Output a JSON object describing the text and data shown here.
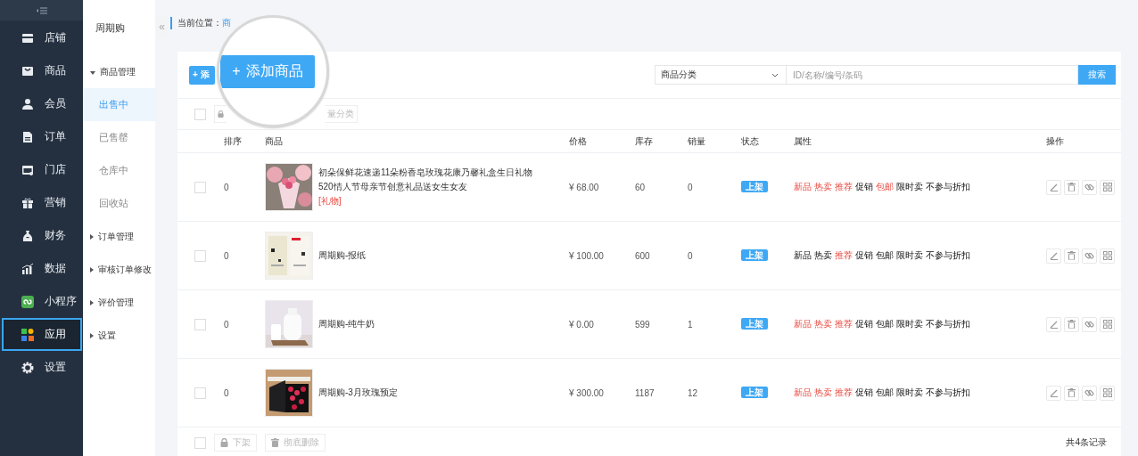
{
  "nav": {
    "items": [
      {
        "label": "店铺",
        "selected": false
      },
      {
        "label": "商品",
        "selected": false
      },
      {
        "label": "会员",
        "selected": false
      },
      {
        "label": "订单",
        "selected": false
      },
      {
        "label": "门店",
        "selected": false
      },
      {
        "label": "营销",
        "selected": false
      },
      {
        "label": "财务",
        "selected": false
      },
      {
        "label": "数据",
        "selected": false
      },
      {
        "label": "小程序",
        "selected": false
      },
      {
        "label": "应用",
        "selected": true
      },
      {
        "label": "设置",
        "selected": false
      }
    ]
  },
  "subnav": {
    "title": "周期购",
    "collapse": "«",
    "groups": [
      {
        "label": "商品管理",
        "expanded": true,
        "children": [
          {
            "label": "出售中",
            "selected": true
          },
          {
            "label": "已售罄",
            "selected": false
          },
          {
            "label": "仓库中",
            "selected": false
          },
          {
            "label": "回收站",
            "selected": false
          }
        ]
      },
      {
        "label": "订单管理",
        "expanded": false
      },
      {
        "label": "审核订单修改",
        "expanded": false
      },
      {
        "label": "评价管理",
        "expanded": false
      },
      {
        "label": "设置",
        "expanded": false
      }
    ]
  },
  "breadcrumb": {
    "label": "当前位置：",
    "link": "商"
  },
  "add_button": {
    "label": "+ 添"
  },
  "magnifier": {
    "icon": "+",
    "button": "添加商品"
  },
  "filter": {
    "category": "商品分类",
    "placeholder": "ID/名称/编号/条码",
    "search": "搜索"
  },
  "toolbar": {
    "select_all": false,
    "buttons": [
      {
        "label": "量分类"
      }
    ]
  },
  "table": {
    "columns": [
      "排序",
      "商品",
      "价格",
      "库存",
      "销量",
      "状态",
      "属性",
      "操作"
    ],
    "rows": [
      {
        "checked": false,
        "order": "0",
        "image": {
          "kind": "picture"
        },
        "name": "初朵保鲜花速递11朵粉香皂玫瑰花康乃馨礼盒生日礼物520情人节母亲节创意礼品送女生女友",
        "tag": "[礼物]",
        "price": "¥ 68.00",
        "stock": "60",
        "sales": "0",
        "status": "上架",
        "attributes": [
          {
            "label": "新品",
            "highlighted": true
          },
          {
            "label": "热卖",
            "highlighted": true
          },
          {
            "label": "推荐",
            "highlighted": true
          },
          {
            "label": "促销",
            "highlighted": false
          },
          {
            "label": "包邮",
            "highlighted": true
          },
          {
            "label": "限时卖",
            "highlighted": false
          },
          {
            "label": "不参与折扣",
            "highlighted": false
          }
        ]
      },
      {
        "checked": false,
        "order": "0",
        "image": {
          "kind": "picture"
        },
        "name": "周期购-报纸",
        "price": "¥ 100.00",
        "stock": "600",
        "sales": "0",
        "status": "上架",
        "attributes": [
          {
            "label": "新品",
            "highlighted": false
          },
          {
            "label": "热卖",
            "highlighted": false
          },
          {
            "label": "推荐",
            "highlighted": true
          },
          {
            "label": "促销",
            "highlighted": false
          },
          {
            "label": "包邮",
            "highlighted": false
          },
          {
            "label": "限时卖",
            "highlighted": false
          },
          {
            "label": "不参与折扣",
            "highlighted": false
          }
        ]
      },
      {
        "checked": false,
        "order": "0",
        "image": {
          "kind": "picture"
        },
        "name": "周期购-纯牛奶",
        "price": "¥ 0.00",
        "stock": "599",
        "sales": "1",
        "status": "上架",
        "attributes": [
          {
            "label": "新品",
            "highlighted": true
          },
          {
            "label": "热卖",
            "highlighted": true
          },
          {
            "label": "推荐",
            "highlighted": true
          },
          {
            "label": "促销",
            "highlighted": false
          },
          {
            "label": "包邮",
            "highlighted": false
          },
          {
            "label": "限时卖",
            "highlighted": false
          },
          {
            "label": "不参与折扣",
            "highlighted": false
          }
        ]
      },
      {
        "checked": false,
        "order": "0",
        "image": {
          "kind": "picture"
        },
        "name": "周期购-3月玫瑰预定",
        "price": "¥ 300.00",
        "stock": "1187",
        "sales": "12",
        "status": "上架",
        "attributes": [
          {
            "label": "新品",
            "highlighted": true
          },
          {
            "label": "热卖",
            "highlighted": true
          },
          {
            "label": "推荐",
            "highlighted": true
          },
          {
            "label": "促销",
            "highlighted": false
          },
          {
            "label": "包邮",
            "highlighted": false
          },
          {
            "label": "限时卖",
            "highlighted": false
          },
          {
            "label": "不参与折扣",
            "highlighted": false
          }
        ]
      }
    ]
  },
  "footer": {
    "select_all": false,
    "buttons": [
      {
        "label": "下架"
      },
      {
        "label": "彻底删除"
      }
    ],
    "total": "共4条记录"
  }
}
